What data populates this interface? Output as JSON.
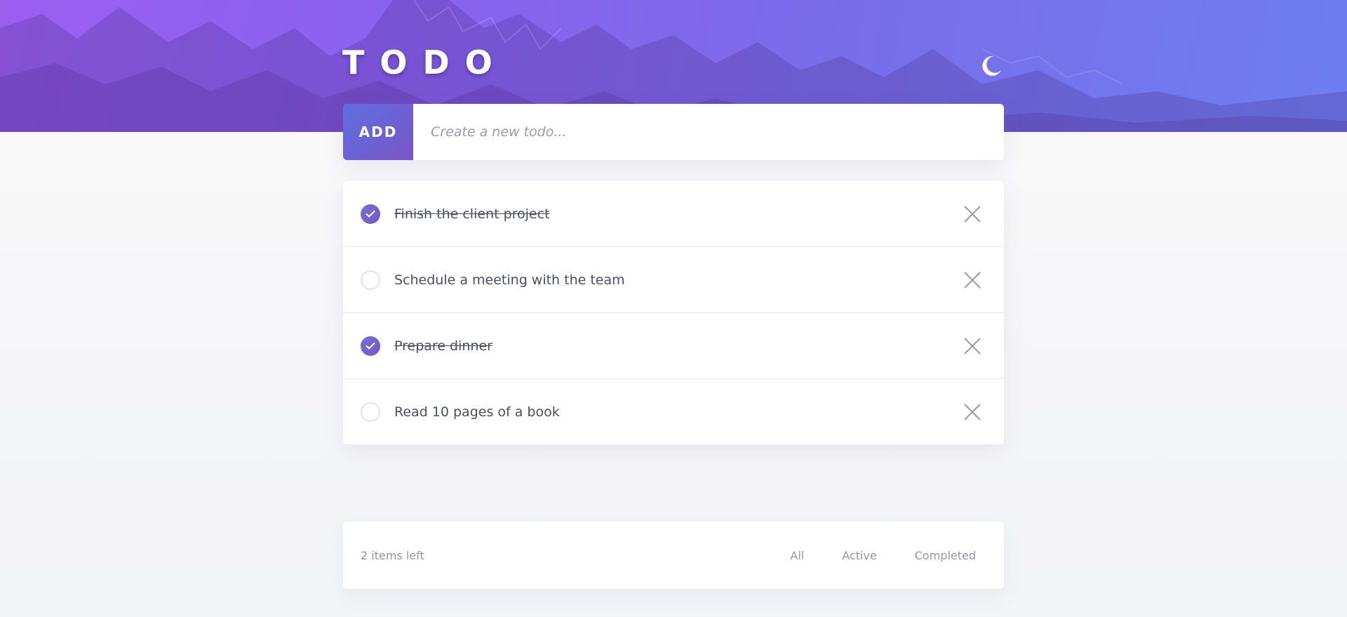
{
  "header": {
    "title": "TODO",
    "theme_toggle_icon": "moon-icon"
  },
  "add": {
    "button_label": "ADD",
    "placeholder": "Create a new todo..."
  },
  "todos": [
    {
      "text": "Finish the client project",
      "completed": true
    },
    {
      "text": "Schedule a meeting with the team",
      "completed": false
    },
    {
      "text": "Prepare dinner",
      "completed": true
    },
    {
      "text": "Read 10 pages of a book",
      "completed": false
    }
  ],
  "footer": {
    "items_left": "2 items left",
    "filters": [
      "All",
      "Active",
      "Completed"
    ]
  },
  "colors": {
    "accent_start": "#6f72d8",
    "accent_end": "#7c55c4",
    "text": "#494c6b",
    "muted": "#9495a5"
  }
}
